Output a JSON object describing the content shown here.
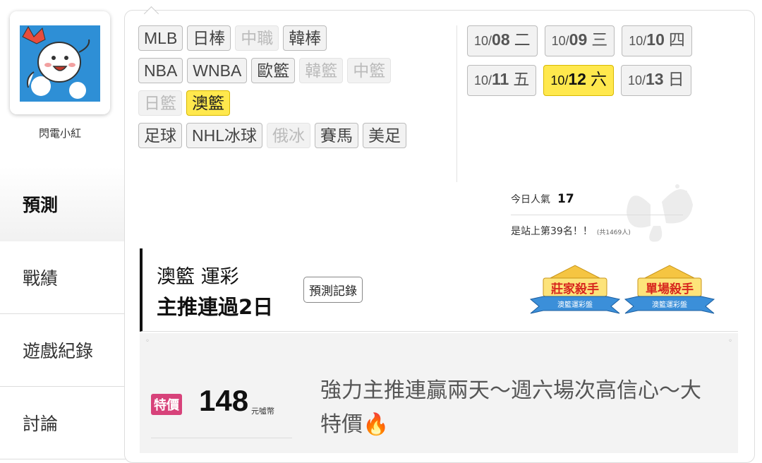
{
  "user": {
    "name": "閃電小紅"
  },
  "sidebar": {
    "items": [
      "預測",
      "戰績",
      "遊戲紀錄",
      "討論"
    ]
  },
  "sports": {
    "rows": [
      [
        {
          "label": "MLB",
          "state": "normal"
        },
        {
          "label": "日棒",
          "state": "normal"
        },
        {
          "label": "中職",
          "state": "disabled"
        },
        {
          "label": "韓棒",
          "state": "normal"
        }
      ],
      [
        {
          "label": "NBA",
          "state": "normal"
        },
        {
          "label": "WNBA",
          "state": "normal"
        },
        {
          "label": "歐籃",
          "state": "normal"
        },
        {
          "label": "韓籃",
          "state": "disabled"
        },
        {
          "label": "中籃",
          "state": "disabled"
        }
      ],
      [
        {
          "label": "日籃",
          "state": "disabled"
        },
        {
          "label": "澳籃",
          "state": "active"
        }
      ],
      [
        {
          "label": "足球",
          "state": "normal"
        },
        {
          "label": "NHL冰球",
          "state": "normal"
        },
        {
          "label": "俄冰",
          "state": "disabled"
        },
        {
          "label": "賽馬",
          "state": "normal"
        },
        {
          "label": "美足",
          "state": "normal"
        }
      ]
    ]
  },
  "dates": {
    "rows": [
      [
        {
          "md": "10/",
          "d": "08",
          "wd": "二",
          "active": false
        },
        {
          "md": "10/",
          "d": "09",
          "wd": "三",
          "active": false
        },
        {
          "md": "10/",
          "d": "10",
          "wd": "四",
          "active": false
        }
      ],
      [
        {
          "md": "10/",
          "d": "11",
          "wd": "五",
          "active": false
        },
        {
          "md": "10/",
          "d": "12",
          "wd": "六",
          "active": true
        },
        {
          "md": "10/",
          "d": "13",
          "wd": "日",
          "active": false
        }
      ]
    ]
  },
  "popularity": {
    "label": "今日人氣",
    "value": "17",
    "rank_text": "是站上第39名！！",
    "total_text": "(共1469人)"
  },
  "banner": {
    "line1": "澳籃 運彩",
    "line2": "主推連過2日",
    "record_button": "預測記錄",
    "badges": [
      {
        "title": "莊家殺手",
        "sub": "澳籃運彩盤"
      },
      {
        "title": "單場殺手",
        "sub": "澳籃運彩盤"
      }
    ]
  },
  "sale": {
    "tag": "特價",
    "price": "148",
    "currency": "元噓幣",
    "promo": "強力主推連贏兩天～週六場次高信心～大特價"
  },
  "colors": {
    "active_yellow": "#ffe84d",
    "sale_pink": "#d7427a"
  }
}
